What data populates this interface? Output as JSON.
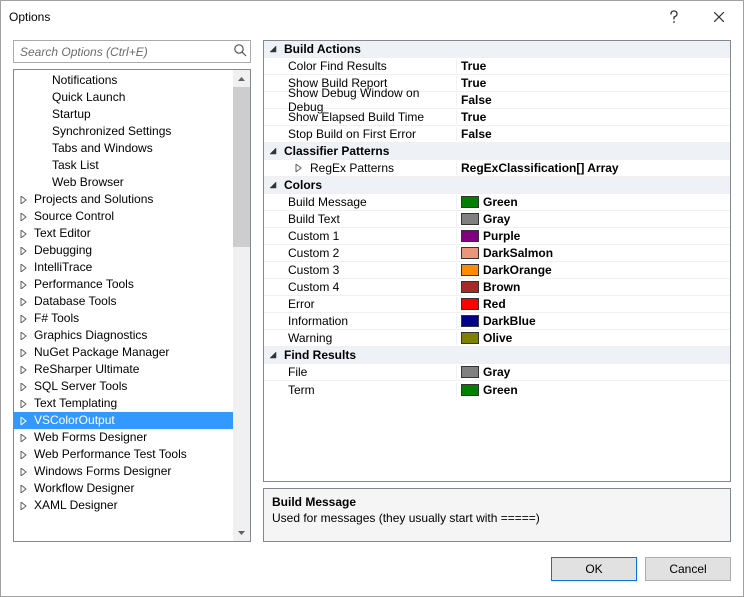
{
  "window": {
    "title": "Options"
  },
  "search": {
    "placeholder": "Search Options (Ctrl+E)"
  },
  "tree": {
    "nodes": [
      {
        "label": "Notifications",
        "depth": 2,
        "expandable": false
      },
      {
        "label": "Quick Launch",
        "depth": 2,
        "expandable": false
      },
      {
        "label": "Startup",
        "depth": 2,
        "expandable": false
      },
      {
        "label": "Synchronized Settings",
        "depth": 2,
        "expandable": false
      },
      {
        "label": "Tabs and Windows",
        "depth": 2,
        "expandable": false
      },
      {
        "label": "Task List",
        "depth": 2,
        "expandable": false
      },
      {
        "label": "Web Browser",
        "depth": 2,
        "expandable": false
      },
      {
        "label": "Projects and Solutions",
        "depth": 1,
        "expandable": true
      },
      {
        "label": "Source Control",
        "depth": 1,
        "expandable": true
      },
      {
        "label": "Text Editor",
        "depth": 1,
        "expandable": true
      },
      {
        "label": "Debugging",
        "depth": 1,
        "expandable": true
      },
      {
        "label": "IntelliTrace",
        "depth": 1,
        "expandable": true
      },
      {
        "label": "Performance Tools",
        "depth": 1,
        "expandable": true
      },
      {
        "label": "Database Tools",
        "depth": 1,
        "expandable": true
      },
      {
        "label": "F# Tools",
        "depth": 1,
        "expandable": true
      },
      {
        "label": "Graphics Diagnostics",
        "depth": 1,
        "expandable": true
      },
      {
        "label": "NuGet Package Manager",
        "depth": 1,
        "expandable": true
      },
      {
        "label": "ReSharper Ultimate",
        "depth": 1,
        "expandable": true
      },
      {
        "label": "SQL Server Tools",
        "depth": 1,
        "expandable": true
      },
      {
        "label": "Text Templating",
        "depth": 1,
        "expandable": true
      },
      {
        "label": "VSColorOutput",
        "depth": 1,
        "expandable": true,
        "selected": true
      },
      {
        "label": "Web Forms Designer",
        "depth": 1,
        "expandable": true
      },
      {
        "label": "Web Performance Test Tools",
        "depth": 1,
        "expandable": true
      },
      {
        "label": "Windows Forms Designer",
        "depth": 1,
        "expandable": true
      },
      {
        "label": "Workflow Designer",
        "depth": 1,
        "expandable": true
      },
      {
        "label": "XAML Designer",
        "depth": 1,
        "expandable": true
      }
    ]
  },
  "propgrid": {
    "rows": [
      {
        "type": "category",
        "label": "Build Actions"
      },
      {
        "type": "item",
        "name": "Color Find Results",
        "value": "True",
        "bold": true
      },
      {
        "type": "item",
        "name": "Show Build Report",
        "value": "True",
        "bold": true
      },
      {
        "type": "item",
        "name": "Show Debug Window on Debug",
        "value": "False",
        "bold": true
      },
      {
        "type": "item",
        "name": "Show Elapsed Build Time",
        "value": "True",
        "bold": true
      },
      {
        "type": "item",
        "name": "Stop Build on First Error",
        "value": "False",
        "bold": true
      },
      {
        "type": "category",
        "label": "Classifier Patterns"
      },
      {
        "type": "item",
        "name": "RegEx Patterns",
        "value": "RegExClassification[] Array",
        "bold": true,
        "sub": true
      },
      {
        "type": "category",
        "label": "Colors"
      },
      {
        "type": "item",
        "name": "Build Message",
        "value": "Green",
        "bold": true,
        "swatch": "#008000"
      },
      {
        "type": "item",
        "name": "Build Text",
        "value": "Gray",
        "bold": true,
        "swatch": "#808080"
      },
      {
        "type": "item",
        "name": "Custom 1",
        "value": "Purple",
        "bold": true,
        "swatch": "#800080"
      },
      {
        "type": "item",
        "name": "Custom 2",
        "value": "DarkSalmon",
        "bold": true,
        "swatch": "#e9967a"
      },
      {
        "type": "item",
        "name": "Custom 3",
        "value": "DarkOrange",
        "bold": true,
        "swatch": "#ff8c00"
      },
      {
        "type": "item",
        "name": "Custom 4",
        "value": "Brown",
        "bold": true,
        "swatch": "#a52a2a"
      },
      {
        "type": "item",
        "name": "Error",
        "value": "Red",
        "bold": true,
        "swatch": "#ff0000"
      },
      {
        "type": "item",
        "name": "Information",
        "value": "DarkBlue",
        "bold": true,
        "swatch": "#00008b"
      },
      {
        "type": "item",
        "name": "Warning",
        "value": "Olive",
        "bold": true,
        "swatch": "#808000"
      },
      {
        "type": "category",
        "label": "Find Results"
      },
      {
        "type": "item",
        "name": "File",
        "value": "Gray",
        "bold": true,
        "swatch": "#808080"
      },
      {
        "type": "item",
        "name": "Term",
        "value": "Green",
        "bold": true,
        "swatch": "#008000"
      }
    ]
  },
  "desc": {
    "title": "Build Message",
    "text": "Used for messages (they usually start with =====)"
  },
  "footer": {
    "ok": "OK",
    "cancel": "Cancel"
  }
}
